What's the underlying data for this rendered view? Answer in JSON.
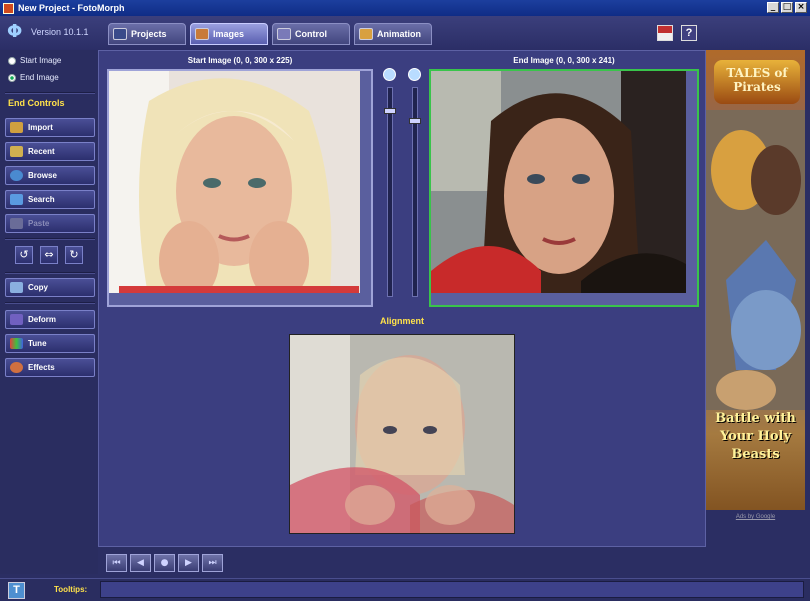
{
  "window": {
    "title": "New Project - FotoMorph"
  },
  "header": {
    "version": "Version 10.1.1",
    "tabs": [
      {
        "label": "Projects",
        "icon": "projects-icon"
      },
      {
        "label": "Images",
        "icon": "images-icon",
        "active": true
      },
      {
        "label": "Control",
        "icon": "control-icon"
      },
      {
        "label": "Animation",
        "icon": "animation-icon"
      }
    ],
    "help_label": "?"
  },
  "sidebar": {
    "radio": [
      {
        "label": "Start Image",
        "selected": false
      },
      {
        "label": "End Image",
        "selected": true
      }
    ],
    "section_label": "End Controls",
    "buttons": {
      "import": "Import",
      "recent": "Recent",
      "browse": "Browse",
      "search": "Search",
      "paste": "Paste",
      "copy": "Copy",
      "deform": "Deform",
      "tune": "Tune",
      "effects": "Effects"
    }
  },
  "main": {
    "start_caption": "Start Image (0, 0, 300 x 225)",
    "end_caption": "End Image (0, 0, 300 x 241)",
    "alignment_label": "Alignment"
  },
  "ad": {
    "logo": "TALES of Pirates",
    "text": "Battle with Your Holy Beasts",
    "footer": "Ads by Google"
  },
  "statusbar": {
    "tooltips_label": "Tooltips:",
    "tooltips_value": ""
  },
  "colors": {
    "accent_yellow": "#ffe24a",
    "panel_bg": "#3b3e80",
    "end_frame_green": "#39c44b"
  }
}
